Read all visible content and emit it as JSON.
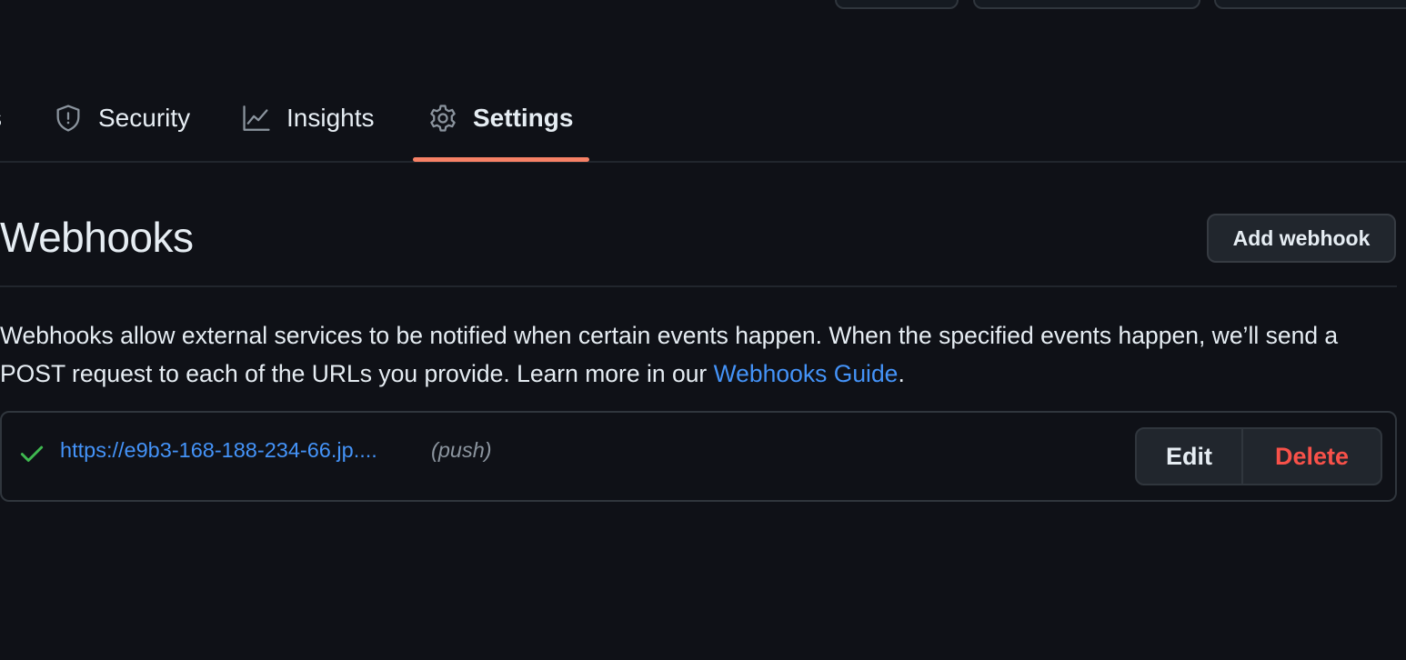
{
  "tabs": {
    "partial_label": "s",
    "security": "Security",
    "insights": "Insights",
    "settings": "Settings"
  },
  "page": {
    "title": "Webhooks",
    "add_button": "Add webhook",
    "description_part1": "Webhooks allow external services to be notified when certain events happen. When the specified events happen, we’ll send a POST request to each of the URLs you provide. Learn more in our ",
    "guide_link": "Webhooks Guide",
    "description_end": "."
  },
  "webhooks": [
    {
      "url": "https://e9b3-168-188-234-66.jp....",
      "events": "(push)",
      "status_icon": "check-icon",
      "edit_label": "Edit",
      "delete_label": "Delete"
    }
  ],
  "colors": {
    "background": "#0f1117",
    "accent_underline": "#f78166",
    "link": "#4493f8",
    "danger": "#f85149",
    "success": "#3fb950"
  }
}
